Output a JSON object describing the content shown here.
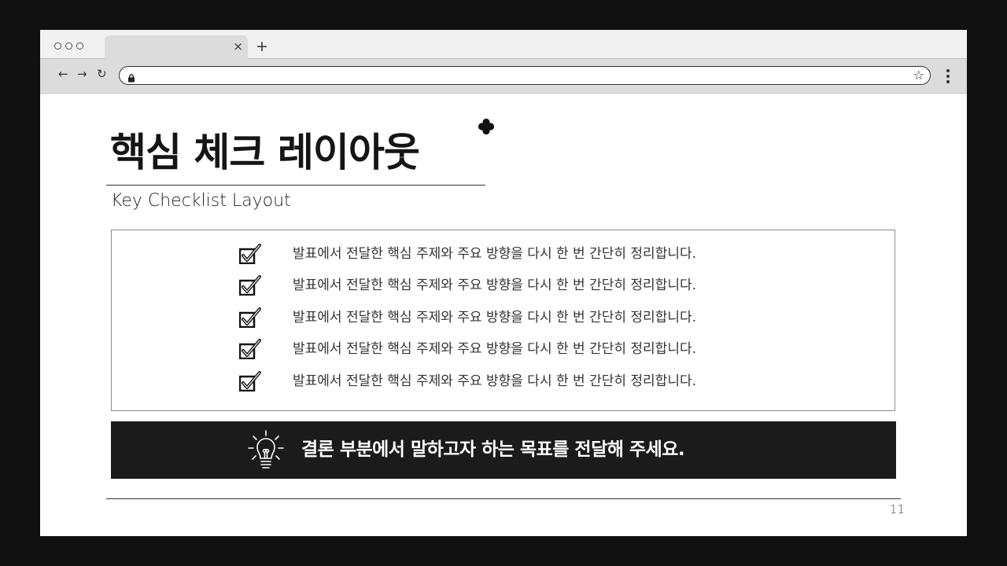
{
  "browser": {
    "tab_close": "×",
    "new_tab": "+",
    "back": "←",
    "forward": "→",
    "reload": "↻",
    "star": "☆",
    "address": "",
    "icons": [
      "window-controls",
      "close-icon",
      "plus-icon",
      "back-arrow-icon",
      "forward-arrow-icon",
      "reload-icon",
      "lock-icon",
      "star-icon",
      "kebab-menu-icon"
    ]
  },
  "slide": {
    "title": "핵심 체크 레이아웃",
    "subtitle": "Key Checklist Layout",
    "checklist": [
      "발표에서 전달한 핵심 주제와 주요 방향을 다시 한 번 간단히 정리합니다.",
      "발표에서 전달한 핵심 주제와 주요 방향을 다시 한 번 간단히 정리합니다.",
      "발표에서 전달한 핵심 주제와 주요 방향을 다시 한 번 간단히 정리합니다.",
      "발표에서 전달한 핵심 주제와 주요 방향을 다시 한 번 간단히 정리합니다.",
      "발표에서 전달한 핵심 주제와 주요 방향을 다시 한 번 간단히 정리합니다."
    ],
    "banner_text": "결론 부분에서 말하고자 하는 목표를 전달해 주세요.",
    "page_number": "11",
    "colors": {
      "background": "#111111",
      "banner": "#1b1b1b",
      "text": "#151515"
    }
  }
}
